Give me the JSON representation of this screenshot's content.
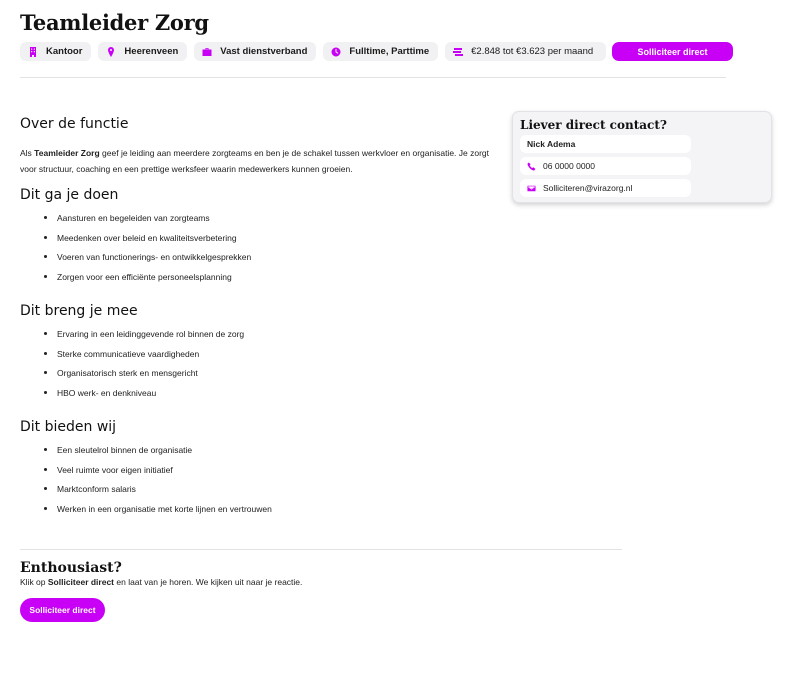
{
  "header": {
    "title": "Teamleider Zorg",
    "tags": [
      {
        "icon": "building-icon",
        "label": "Kantoor"
      },
      {
        "icon": "map-pin-icon",
        "label": "Heerenveen"
      },
      {
        "icon": "briefcase-icon",
        "label": "Vast dienstverband"
      },
      {
        "icon": "clock-icon",
        "label": "Fulltime, Parttime"
      },
      {
        "icon": "money-icon",
        "label": "€2.848 tot €3.623 per maand"
      }
    ],
    "apply_label": "Solliciteer direct"
  },
  "main": {
    "about_heading": "Over de functie",
    "intro_prefix": "Als ",
    "intro_bold": "Teamleider Zorg",
    "intro_rest": " geef je leiding aan meerdere zorgteams en ben je de schakel tussen werkvloer en organisatie. Je zorgt voor structuur, coaching en een prettige werksfeer waarin medewerkers kunnen groeien.",
    "sections": [
      {
        "heading": "Dit ga je doen",
        "items": [
          "Aansturen en begeleiden van zorgteams",
          "Meedenken over beleid en kwaliteitsverbetering",
          "Voeren van functionerings- en ontwikkelgesprekken",
          "Zorgen voor een efficiënte personeelsplanning"
        ]
      },
      {
        "heading": "Dit breng je mee",
        "items": [
          "Ervaring in een leidinggevende rol binnen de zorg",
          "Sterke communicatieve vaardigheden",
          "Organisatorisch sterk en mensgericht",
          "HBO werk- en denkniveau"
        ]
      },
      {
        "heading": "Dit bieden wij",
        "items": [
          "Een sleutelrol binnen de organisatie",
          "Veel ruimte voor eigen initiatief",
          "Marktconform salaris",
          "Werken in een organisatie met korte lijnen en vertrouwen"
        ]
      }
    ]
  },
  "contact": {
    "heading": "Liever direct contact?",
    "name": "Nick Adema",
    "phone": "06 0000 0000",
    "email": "Solliciteren@virazorg.nl"
  },
  "footer": {
    "heading": "Enthousiast?",
    "text_prefix": "Klik op ",
    "text_bold": "Solliciteer direct",
    "text_rest": " en laat van je horen. We kijken uit naar je reactie.",
    "apply_label": "Solliciteer direct"
  },
  "colors": {
    "accent": "#c800f5",
    "tag_bg": "#f1f1f3"
  }
}
